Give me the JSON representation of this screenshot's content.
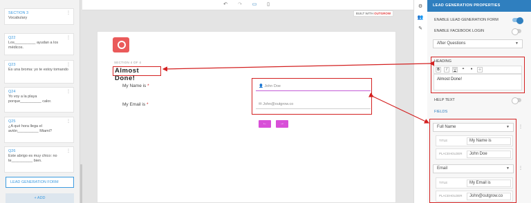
{
  "sidebar": {
    "cards": [
      {
        "number": "SECTION 3",
        "text": "Vocabulary"
      },
      {
        "number": "Q22",
        "text": "Los__________ ayudan a los médicos."
      },
      {
        "number": "Q23",
        "text": "Es una broma: yo te estoy tomando"
      },
      {
        "number": "Q24",
        "text": "Yo voy a la playa porque__________ calor."
      },
      {
        "number": "Q25",
        "text": "¿A qué hora llega el avión__________ Miami?"
      },
      {
        "number": "Q26",
        "text": "Este abrigo es muy chico: no te__________ bien."
      }
    ],
    "lead_form_button": "LEAD GENERATION FORM",
    "add_button": "+ ADD"
  },
  "toolbar": {
    "icons": [
      "undo-icon",
      "redo-icon",
      "desktop-icon",
      "mobile-icon"
    ],
    "built_with": "BUILT WITH",
    "brand": "OUTGROW"
  },
  "canvas": {
    "section_label": "SECTION 4 OF 4",
    "heading": "Almost Done!",
    "fields": [
      {
        "label": "My Name is",
        "placeholder": "John Doe"
      },
      {
        "label": "My Email is",
        "placeholder": "John@outgrow.co"
      }
    ],
    "prev_button": "←",
    "next_button": "→"
  },
  "panel": {
    "title": "LEAD GENERATION PROPERTIES",
    "enable_form": "ENABLE LEAD GENERATION FORM",
    "enable_facebook": "ENABLE FACEBOOK LOGIN",
    "position_select": "After Questions",
    "heading_label": "HEADING",
    "rte_buttons": [
      "B",
      "I",
      "U",
      "⚭",
      "♦",
      "‹›"
    ],
    "heading_value": "Almost Done!",
    "help_text": "HELP TEXT",
    "fields_label": "FIELDS",
    "field_items": [
      {
        "type": "Full Name",
        "title_key": "TITLE",
        "title": "My Name is",
        "placeholder_key": "PLACEHOLDER",
        "placeholder": "John Doe"
      },
      {
        "type": "Email",
        "title_key": "TITLE",
        "title": "My Email is",
        "placeholder_key": "PLACEHOLDER",
        "placeholder": "John@outgrow.co"
      }
    ]
  },
  "colors": {
    "accent": "#2f7fbf",
    "annotation": "#d32020",
    "button": "#d84fd8"
  }
}
